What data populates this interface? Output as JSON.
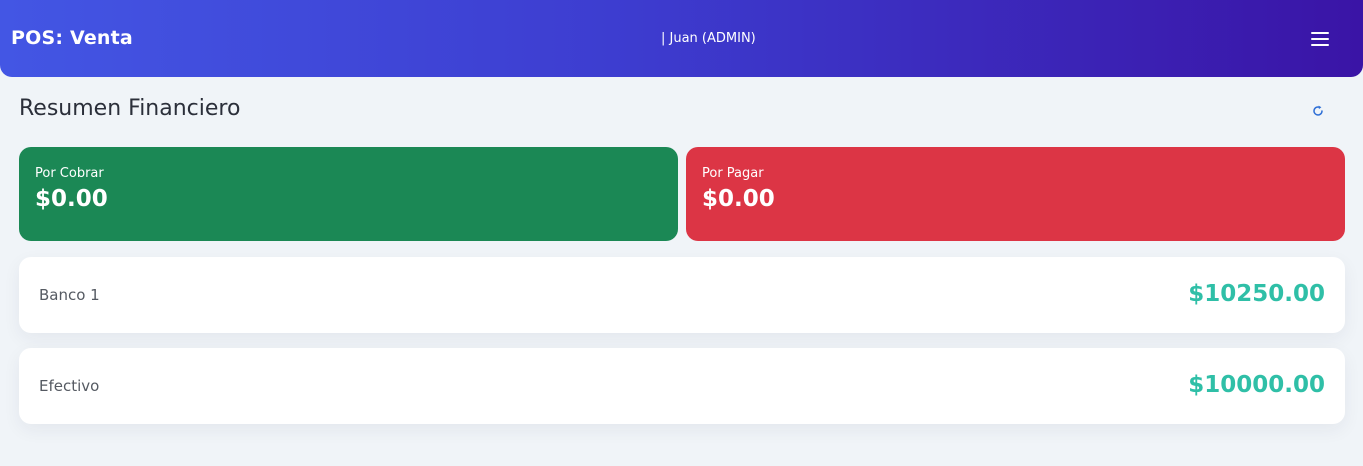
{
  "header": {
    "app_title": "POS: Venta",
    "user_label": "| Juan (ADMIN)",
    "menu_icon": "hamburger-menu-icon"
  },
  "summary": {
    "title": "Resumen Financiero",
    "refresh_icon": "refresh-icon",
    "receivable": {
      "label": "Por Cobrar",
      "amount": "$0.00",
      "color": "#1b8855"
    },
    "payable": {
      "label": "Por Pagar",
      "amount": "$0.00",
      "color": "#dc3545"
    }
  },
  "accounts": [
    {
      "name": "Banco 1",
      "balance": "$10250.00"
    },
    {
      "name": "Efectivo",
      "balance": "$10000.00"
    }
  ],
  "colors": {
    "header_gradient_start": "#4356e4",
    "header_gradient_end": "#3a14a6",
    "balance_text": "#2fbfa7",
    "page_background": "#f0f4f8"
  }
}
